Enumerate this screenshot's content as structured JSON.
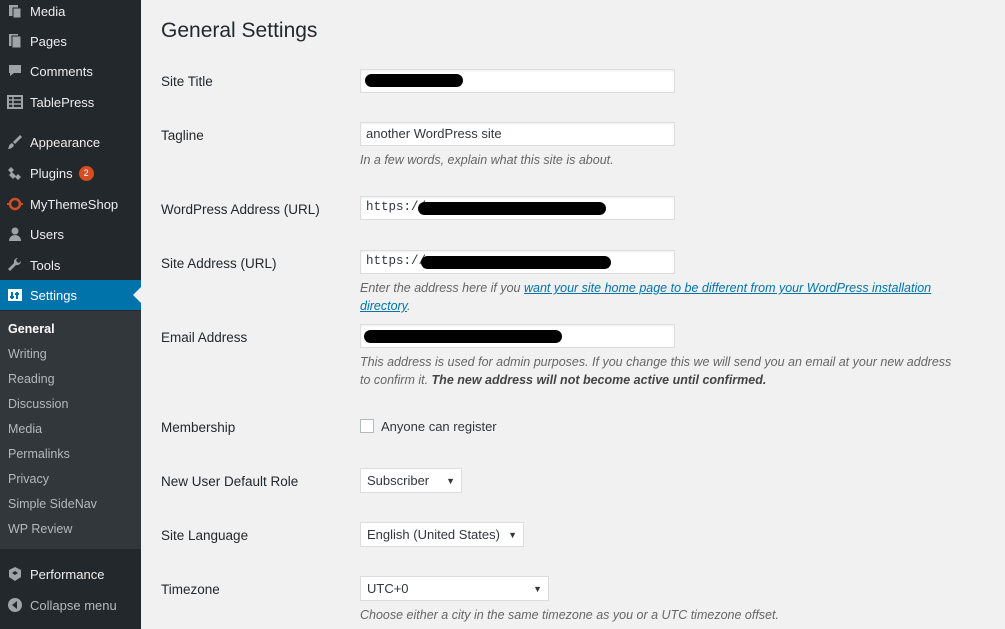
{
  "sidebar": {
    "items": [
      {
        "label": "Media",
        "icon": "media-icon"
      },
      {
        "label": "Pages",
        "icon": "pages-icon"
      },
      {
        "label": "Comments",
        "icon": "comments-icon"
      },
      {
        "label": "TablePress",
        "icon": "table-icon"
      },
      {
        "label": "Appearance",
        "icon": "paintbrush-icon"
      },
      {
        "label": "Plugins",
        "icon": "plugin-icon",
        "badge": "2"
      },
      {
        "label": "MyThemeShop",
        "icon": "mythemeshop-icon"
      },
      {
        "label": "Users",
        "icon": "users-icon"
      },
      {
        "label": "Tools",
        "icon": "wrench-icon"
      },
      {
        "label": "Settings",
        "icon": "settings-icon"
      }
    ],
    "submenu": [
      "General",
      "Writing",
      "Reading",
      "Discussion",
      "Media",
      "Permalinks",
      "Privacy",
      "Simple SideNav",
      "WP Review"
    ],
    "performance": "Performance",
    "collapse": "Collapse menu"
  },
  "main": {
    "title": "General Settings",
    "site_title_label": "Site Title",
    "tagline_label": "Tagline",
    "tagline_value": "another WordPress site",
    "tagline_desc": "In a few words, explain what this site is about.",
    "wp_address_label": "WordPress Address (URL)",
    "wp_address_prefix": "https://",
    "site_address_label": "Site Address (URL)",
    "site_address_prefix": "https://",
    "site_address_desc_pre": "Enter the address here if you ",
    "site_address_desc_link": "want your site home page to be different from your WordPress installation directory",
    "site_address_desc_post": ".",
    "email_label": "Email Address",
    "email_desc": "This address is used for admin purposes. If you change this we will send you an email at your new address to confirm it. ",
    "email_desc_bold": "The new address will not become active until confirmed.",
    "membership_label": "Membership",
    "membership_checkbox": "Anyone can register",
    "default_role_label": "New User Default Role",
    "default_role_value": "Subscriber",
    "language_label": "Site Language",
    "language_value": "English (United States)",
    "timezone_label": "Timezone",
    "timezone_value": "UTC+0",
    "timezone_desc": "Choose either a city in the same timezone as you or a UTC timezone offset."
  },
  "colors": {
    "sidebar_bg": "#23282d",
    "submenu_bg": "#32373c",
    "accent": "#0073aa",
    "badge": "#d54e21"
  }
}
